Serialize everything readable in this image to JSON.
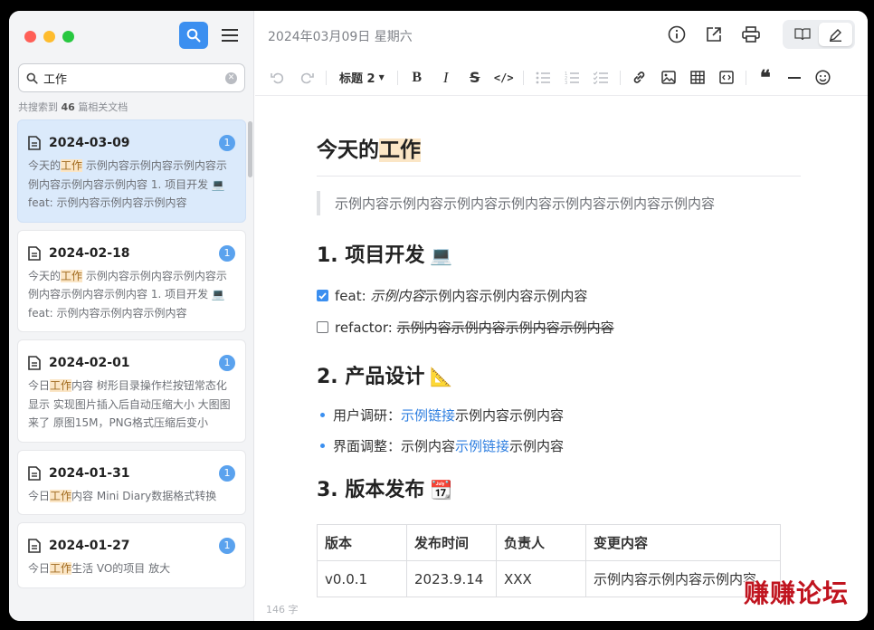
{
  "sidebar": {
    "search_value": "工作",
    "result_count_prefix": "共搜索到",
    "result_count": "46",
    "result_count_suffix": "篇相关文档",
    "docs": [
      {
        "date": "2024-03-09",
        "badge": "1",
        "pre": "今天的",
        "hit": "工作",
        "post": " 示例内容示例内容示例内容示例内容示例内容示例内容 1. 项目开发 💻 feat: 示例内容示例内容示例内容"
      },
      {
        "date": "2024-02-18",
        "badge": "1",
        "pre": "今天的",
        "hit": "工作",
        "post": " 示例内容示例内容示例内容示例内容示例内容示例内容 1. 项目开发 💻 feat: 示例内容示例内容示例内容"
      },
      {
        "date": "2024-02-01",
        "badge": "1",
        "pre": "今日",
        "hit": "工作",
        "post": "内容 树形目录操作栏按钮常态化显示 实现图片插入后自动压缩大小 大图图来了 原图15M，PNG格式压缩后变小"
      },
      {
        "date": "2024-01-31",
        "badge": "1",
        "pre": "今日",
        "hit": "工作",
        "post": "内容 Mini Diary数据格式转换"
      },
      {
        "date": "2024-01-27",
        "badge": "1",
        "pre": "今日",
        "hit": "工作",
        "post": "生活 VO的项目 放大"
      }
    ]
  },
  "header": {
    "date_title": "2024年03月09日 星期六"
  },
  "toolbar": {
    "heading_select": "标题 2"
  },
  "document": {
    "title_pre": "今天的",
    "title_hit": "工作",
    "quote": "示例内容示例内容示例内容示例内容示例内容示例内容示例内容",
    "section1": {
      "heading": "1. 项目开发",
      "emoji": "💻"
    },
    "tasks": [
      {
        "checked": true,
        "label": "feat: ",
        "italic": "示例内容",
        "rest": "示例内容示例内容示例内容"
      },
      {
        "checked": false,
        "label": "refactor: ",
        "strike": "示例内容示例内容示例内容示例内容"
      }
    ],
    "section2": {
      "heading": "2. 产品设计",
      "emoji": "📐"
    },
    "bullets": [
      {
        "pre": "用户调研：",
        "link": "示例链接",
        "post": "示例内容示例内容"
      },
      {
        "pre": "界面调整：示例内容",
        "link": "示例链接",
        "post": "示例内容"
      }
    ],
    "section3": {
      "heading": "3. 版本发布",
      "emoji": "📆"
    },
    "table": {
      "headers": [
        "版本",
        "发布时间",
        "负责人",
        "变更内容"
      ],
      "rows": [
        [
          "v0.0.1",
          "2023.9.14",
          "XXX",
          "示例内容示例内容示例内容"
        ]
      ]
    }
  },
  "footer": {
    "word_count": "146 字"
  },
  "watermark": "赚赚论坛",
  "colors": {
    "accent": "#3b8ff0",
    "highlight": "#fbe6c6",
    "active_card": "#dbeafb"
  }
}
